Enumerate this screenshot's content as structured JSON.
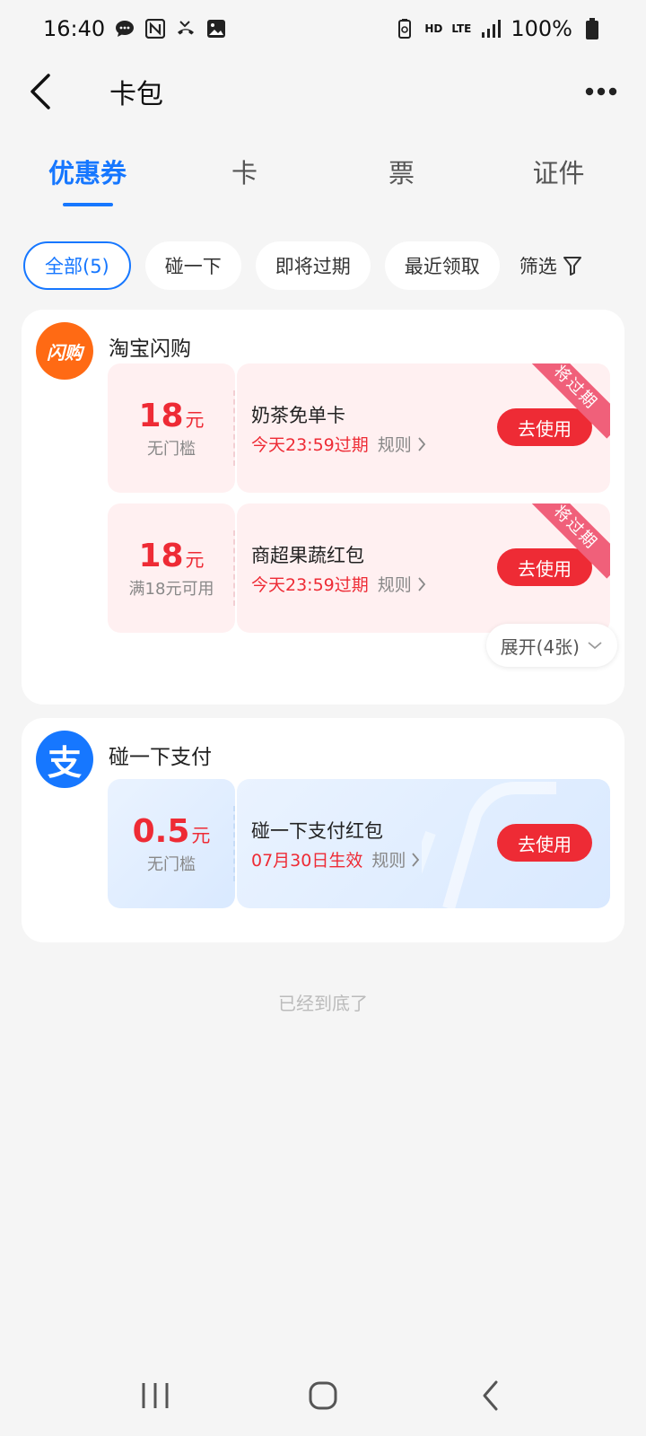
{
  "status_bar": {
    "time": "16:40",
    "network_hd": "HD",
    "network_lte": "LTE",
    "battery": "100%"
  },
  "nav": {
    "title": "卡包"
  },
  "tabs": [
    {
      "label": "优惠券",
      "active": true
    },
    {
      "label": "卡",
      "active": false
    },
    {
      "label": "票",
      "active": false
    },
    {
      "label": "证件",
      "active": false
    }
  ],
  "filters": {
    "chips": [
      {
        "label": "全部(5)",
        "active": true
      },
      {
        "label": "碰一下",
        "active": false
      },
      {
        "label": "即将过期",
        "active": false
      },
      {
        "label": "最近领取",
        "active": false
      }
    ],
    "filter_label": "筛选"
  },
  "merchants": [
    {
      "name": "淘宝闪购",
      "logo_text": "闪购",
      "coupons": [
        {
          "amount": "18",
          "unit": "元",
          "threshold": "无门槛",
          "title": "奶茶免单卡",
          "expire": "今天23:59过期",
          "rule": "规则",
          "button": "去使用",
          "ribbon": "将过期"
        },
        {
          "amount": "18",
          "unit": "元",
          "threshold": "满18元可用",
          "title": "商超果蔬红包",
          "expire": "今天23:59过期",
          "rule": "规则",
          "button": "去使用",
          "ribbon": "将过期"
        }
      ],
      "expand": "展开(4张)"
    },
    {
      "name": "碰一下支付",
      "logo_text": "支",
      "coupons": [
        {
          "amount": "0.5",
          "unit": "元",
          "threshold": "无门槛",
          "title": "碰一下支付红包",
          "expire": "07月30日生效",
          "rule": "规则",
          "button": "去使用"
        }
      ]
    }
  ],
  "footer": "已经到底了",
  "colors": {
    "accent": "#1677ff",
    "price_red": "#ee2b35",
    "ribbon_pink": "#f0607a",
    "taobao_orange": "#ff6a14"
  }
}
